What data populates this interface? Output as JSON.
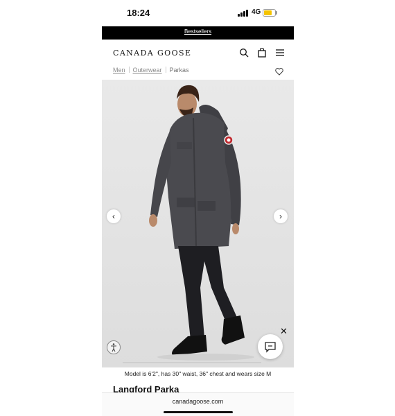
{
  "status_bar": {
    "time": "18:24",
    "network": "4G",
    "battery_level": 0.7,
    "battery_color": "#f5c400"
  },
  "promo": {
    "link": "Bestsellers"
  },
  "header": {
    "logo": "CANADA GOOSE",
    "icons": [
      "search-icon",
      "bag-icon",
      "menu-icon"
    ]
  },
  "breadcrumb": {
    "items": [
      "Men",
      "Outerwear",
      "Parkas"
    ]
  },
  "gallery": {
    "prev_icon": "‹",
    "next_icon": "›",
    "close_icon": "✕"
  },
  "product": {
    "model_note": "Model is 6'2\", has 30\" waist, 36\" chest and wears size M",
    "title": "Langford Parka"
  },
  "browser": {
    "url": "canadagoose.com"
  },
  "colors": {
    "promo_bg": "#000000",
    "gallery_bg": "#e6e6e6",
    "parka": "#4a4a4f"
  }
}
